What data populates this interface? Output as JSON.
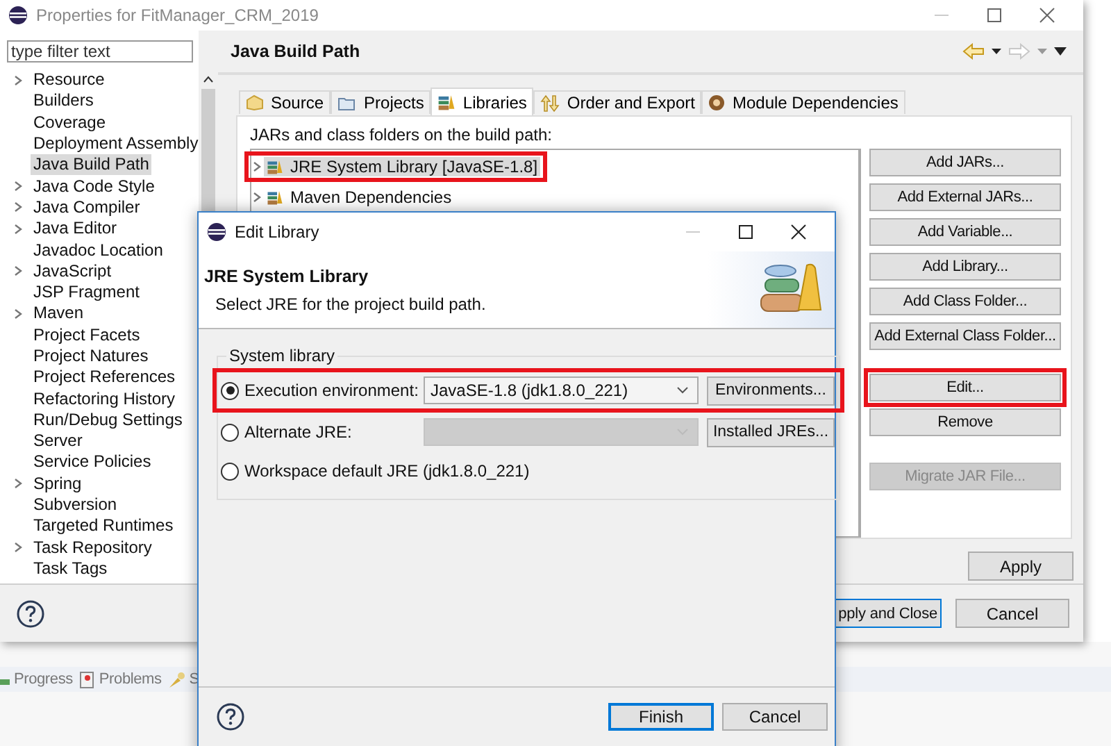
{
  "main_window": {
    "title": "Properties for FitManager_CRM_2019"
  },
  "filter": {
    "placeholder": "type filter text"
  },
  "sidebar": {
    "items": [
      {
        "label": "Resource",
        "expandable": true,
        "selected": false
      },
      {
        "label": "Builders",
        "expandable": false,
        "selected": false
      },
      {
        "label": "Coverage",
        "expandable": false,
        "selected": false
      },
      {
        "label": "Deployment Assembly",
        "expandable": false,
        "selected": false
      },
      {
        "label": "Java Build Path",
        "expandable": false,
        "selected": true
      },
      {
        "label": "Java Code Style",
        "expandable": true,
        "selected": false
      },
      {
        "label": "Java Compiler",
        "expandable": true,
        "selected": false
      },
      {
        "label": "Java Editor",
        "expandable": true,
        "selected": false
      },
      {
        "label": "Javadoc Location",
        "expandable": false,
        "selected": false
      },
      {
        "label": "JavaScript",
        "expandable": true,
        "selected": false
      },
      {
        "label": "JSP Fragment",
        "expandable": false,
        "selected": false
      },
      {
        "label": "Maven",
        "expandable": true,
        "selected": false
      },
      {
        "label": "Project Facets",
        "expandable": false,
        "selected": false
      },
      {
        "label": "Project Natures",
        "expandable": false,
        "selected": false
      },
      {
        "label": "Project References",
        "expandable": false,
        "selected": false
      },
      {
        "label": "Refactoring History",
        "expandable": false,
        "selected": false
      },
      {
        "label": "Run/Debug Settings",
        "expandable": false,
        "selected": false
      },
      {
        "label": "Server",
        "expandable": false,
        "selected": false
      },
      {
        "label": "Service Policies",
        "expandable": false,
        "selected": false
      },
      {
        "label": "Spring",
        "expandable": true,
        "selected": false
      },
      {
        "label": "Subversion",
        "expandable": false,
        "selected": false
      },
      {
        "label": "Targeted Runtimes",
        "expandable": false,
        "selected": false
      },
      {
        "label": "Task Repository",
        "expandable": true,
        "selected": false
      },
      {
        "label": "Task Tags",
        "expandable": false,
        "selected": false
      }
    ]
  },
  "page": {
    "title": "Java Build Path",
    "tabs": [
      {
        "label": "Source",
        "kind": "source",
        "selected": false
      },
      {
        "label": "Projects",
        "kind": "projects",
        "selected": false
      },
      {
        "label": "Libraries",
        "kind": "libraries",
        "selected": true
      },
      {
        "label": "Order and Export",
        "kind": "order",
        "selected": false
      },
      {
        "label": "Module Dependencies",
        "kind": "module",
        "selected": false
      }
    ],
    "caption": "JARs and class folders on the build path:",
    "libraries": [
      {
        "label": "JRE System Library [JavaSE-1.8]",
        "selected": true,
        "highlighted": true
      },
      {
        "label": "Maven Dependencies",
        "selected": false,
        "highlighted": false
      }
    ],
    "buttons": [
      {
        "label": "Add JARs...",
        "disabled": false,
        "highlighted": false
      },
      {
        "label": "Add External JARs...",
        "disabled": false,
        "highlighted": false
      },
      {
        "label": "Add Variable...",
        "disabled": false,
        "highlighted": false
      },
      {
        "label": "Add Library...",
        "disabled": false,
        "highlighted": false
      },
      {
        "label": "Add Class Folder...",
        "disabled": false,
        "highlighted": false
      },
      {
        "label": "Add External Class Folder...",
        "disabled": false,
        "highlighted": false
      },
      {
        "label": "Edit...",
        "disabled": false,
        "highlighted": true
      },
      {
        "label": "Remove",
        "disabled": false,
        "highlighted": false
      },
      {
        "label": "Migrate JAR File...",
        "disabled": true,
        "highlighted": false
      }
    ],
    "apply": "Apply"
  },
  "footer": {
    "buttons": [
      {
        "label": "pply and Close",
        "default": true
      },
      {
        "label": "Cancel",
        "default": false
      }
    ]
  },
  "views": [
    {
      "label": "Progress",
      "kind": "progress"
    },
    {
      "label": "Problems",
      "kind": "problems"
    },
    {
      "label": "S",
      "kind": "search"
    }
  ],
  "dialog": {
    "title": "Edit Library",
    "heading": "JRE System Library",
    "description": "Select JRE for the project build path.",
    "group": "System library",
    "options": [
      {
        "label": "Execution environment:",
        "selected": true,
        "highlighted": true,
        "combo": {
          "value": "JavaSE-1.8 (jdk1.8.0_221)",
          "disabled": false
        },
        "button": "Environments..."
      },
      {
        "label": "Alternate JRE:",
        "selected": false,
        "highlighted": false,
        "combo": {
          "disabled": true
        },
        "button": "Installed JREs..."
      },
      {
        "label": "Workspace default JRE (jdk1.8.0_221)",
        "selected": false,
        "highlighted": false
      }
    ],
    "buttons": [
      {
        "label": "Finish",
        "default": true
      },
      {
        "label": "Cancel",
        "default": false
      }
    ]
  }
}
